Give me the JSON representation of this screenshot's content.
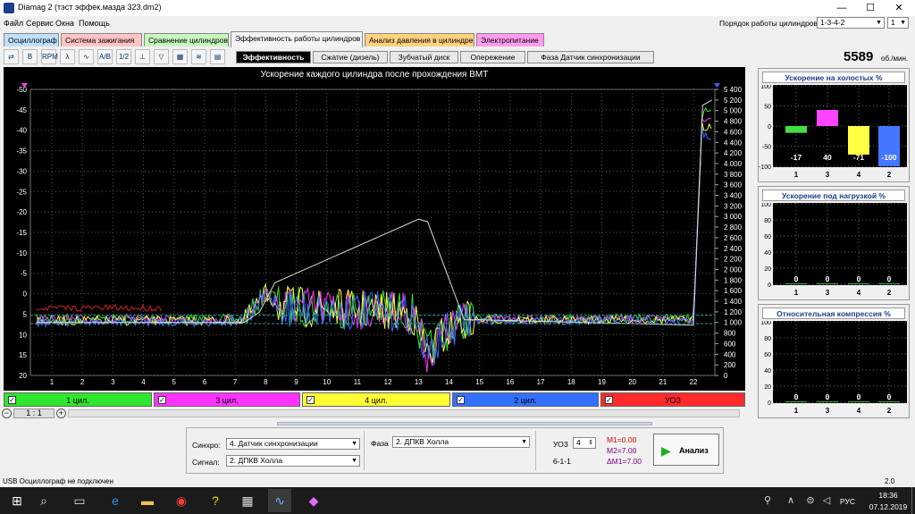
{
  "app": {
    "title": "Diamag 2 (тэст эффек.мазда 323.dm2)"
  },
  "menu": [
    "Файл",
    "Сервис",
    "Окна",
    "Помощь"
  ],
  "cyl_order": {
    "label": "Порядок работы цилиндров",
    "value": "1-3-4-2",
    "num": "1"
  },
  "tabs": [
    "Осциллограф",
    "Система зажигания",
    "Сравнение цилиндров",
    "Эффективность работы цилиндров",
    "Анализ давления в цилиндре",
    "Электропитание"
  ],
  "tab_colors": [
    "#bfe0ff",
    "#ffc4c4",
    "#c8f7c0",
    "#f4f4f4",
    "#ffd27f",
    "#ff9cf0"
  ],
  "subtabs": [
    "Эффективность",
    "Сжатие (дизель)",
    "Зубчатый диск",
    "Опережение",
    "Фаза Датчик синхронизации"
  ],
  "toolbar_icons": [
    "cursor-icon",
    "bold-b-icon",
    "rpm-icon",
    "lambda-icon",
    "graph-icon",
    "abc-icon",
    "abs-icon",
    "connect-icon",
    "filter-icon",
    "cylinder-icon",
    "wave-icon",
    "block-icon"
  ],
  "toolbar_glyphs": [
    "⇄",
    "B",
    "RPM",
    "λ",
    "∿",
    "A/B",
    "1/2",
    "⊥",
    "▽",
    "▦",
    "≋",
    "▤"
  ],
  "chart": {
    "title": "Ускорение каждого цилиндра после прохождения ВМТ",
    "left_ticks": [
      "-50",
      "-45",
      "-40",
      "-35",
      "-30",
      "-25",
      "-20",
      "-15",
      "-10",
      "-5",
      "0",
      "5",
      "10",
      "15",
      "20"
    ],
    "right_ticks": [
      "5 400",
      "5 200",
      "5 000",
      "4 800",
      "4 600",
      "4 400",
      "4 200",
      "4 000",
      "3 800",
      "3 600",
      "3 400",
      "3 200",
      "3 000",
      "2 800",
      "2 600",
      "2 400",
      "2 200",
      "2 000",
      "1 800",
      "1 600",
      "1 400",
      "1 200",
      "1 000",
      "800",
      "600",
      "400",
      "200",
      "0"
    ],
    "x_ticks": [
      "1",
      "2",
      "3",
      "4",
      "5",
      "6",
      "7",
      "8",
      "9",
      "10",
      "11",
      "12",
      "13",
      "14",
      "15",
      "16",
      "17",
      "18",
      "19",
      "20",
      "21",
      "22"
    ]
  },
  "channels": [
    {
      "label": "1 цил.",
      "color": "#2ee62e"
    },
    {
      "label": "3 цил.",
      "color": "#ff33ff"
    },
    {
      "label": "4 цил.",
      "color": "#ffff33"
    },
    {
      "label": "2 цил.",
      "color": "#3370ff"
    },
    {
      "label": "УОЗ",
      "color": "#ff2a2a"
    }
  ],
  "zoom": {
    "value": "1 : 1"
  },
  "rpm": {
    "value": "5589",
    "unit": "об./мин."
  },
  "panels": [
    {
      "title": "Ускорение на холостых %",
      "yticks": [
        "100",
        "50",
        "0",
        "-50",
        "-100"
      ],
      "cats": [
        "1",
        "3",
        "4",
        "2"
      ],
      "values": [
        "-17",
        "40",
        "-71",
        "-100"
      ],
      "nums": [
        -17,
        40,
        -71,
        -100
      ],
      "colors": [
        "#44dd44",
        "#ff44ff",
        "#ffff44",
        "#4477ff"
      ]
    },
    {
      "title": "Ускорение под нагрузкой %",
      "yticks": [
        "100",
        "80",
        "60",
        "40",
        "20",
        "0"
      ],
      "cats": [
        "1",
        "3",
        "4",
        "2"
      ],
      "values": [
        "0",
        "0",
        "0",
        "0"
      ]
    },
    {
      "title": "Относительная компрессия %",
      "yticks": [
        "100",
        "80",
        "60",
        "40",
        "20",
        "0"
      ],
      "cats": [
        "1",
        "3",
        "4",
        "2"
      ],
      "values": [
        "0",
        "0",
        "0",
        "0"
      ]
    }
  ],
  "controls": {
    "sync_label": "Синхро:",
    "sync_value": "4.  Датчик синхронизации",
    "signal_label": "Сигнал:",
    "signal_value": "2.  ДПКВ Холла",
    "phase_label": "Фаза",
    "phase_value": "2.  ДПКВ Холла",
    "uoz_label": "УОЗ",
    "uoz_value": "4",
    "tooth": "6-1-1",
    "m1": "M1=0.00",
    "m2": "M2=7.00",
    "dm": "ΔM1=7.00",
    "analyze": "Анализ"
  },
  "status": {
    "left": "USB Осциллограф не подключен",
    "right": "2.0"
  },
  "taskbar": {
    "lang": "РУС",
    "time": "18:36",
    "date": "07.12.2019"
  }
}
